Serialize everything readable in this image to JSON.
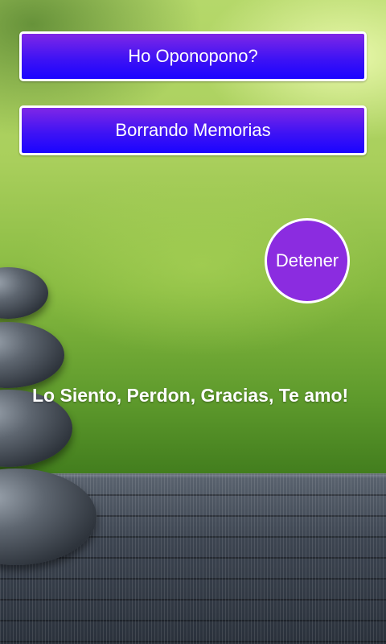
{
  "buttons": {
    "ho_oponopono": "Ho Oponopono?",
    "borrando_memorias": "Borrando Memorias",
    "detener": "Detener"
  },
  "affirmation": "Lo Siento, Perdon, Gracias, Te amo!",
  "colors": {
    "button_gradient_top": "#7f27e6",
    "button_gradient_bottom": "#1a04ff",
    "round_button": "#8b2ce0",
    "text": "#ffffff"
  },
  "background": {
    "scene": "zen stones on bamboo mat with green blurred background"
  }
}
